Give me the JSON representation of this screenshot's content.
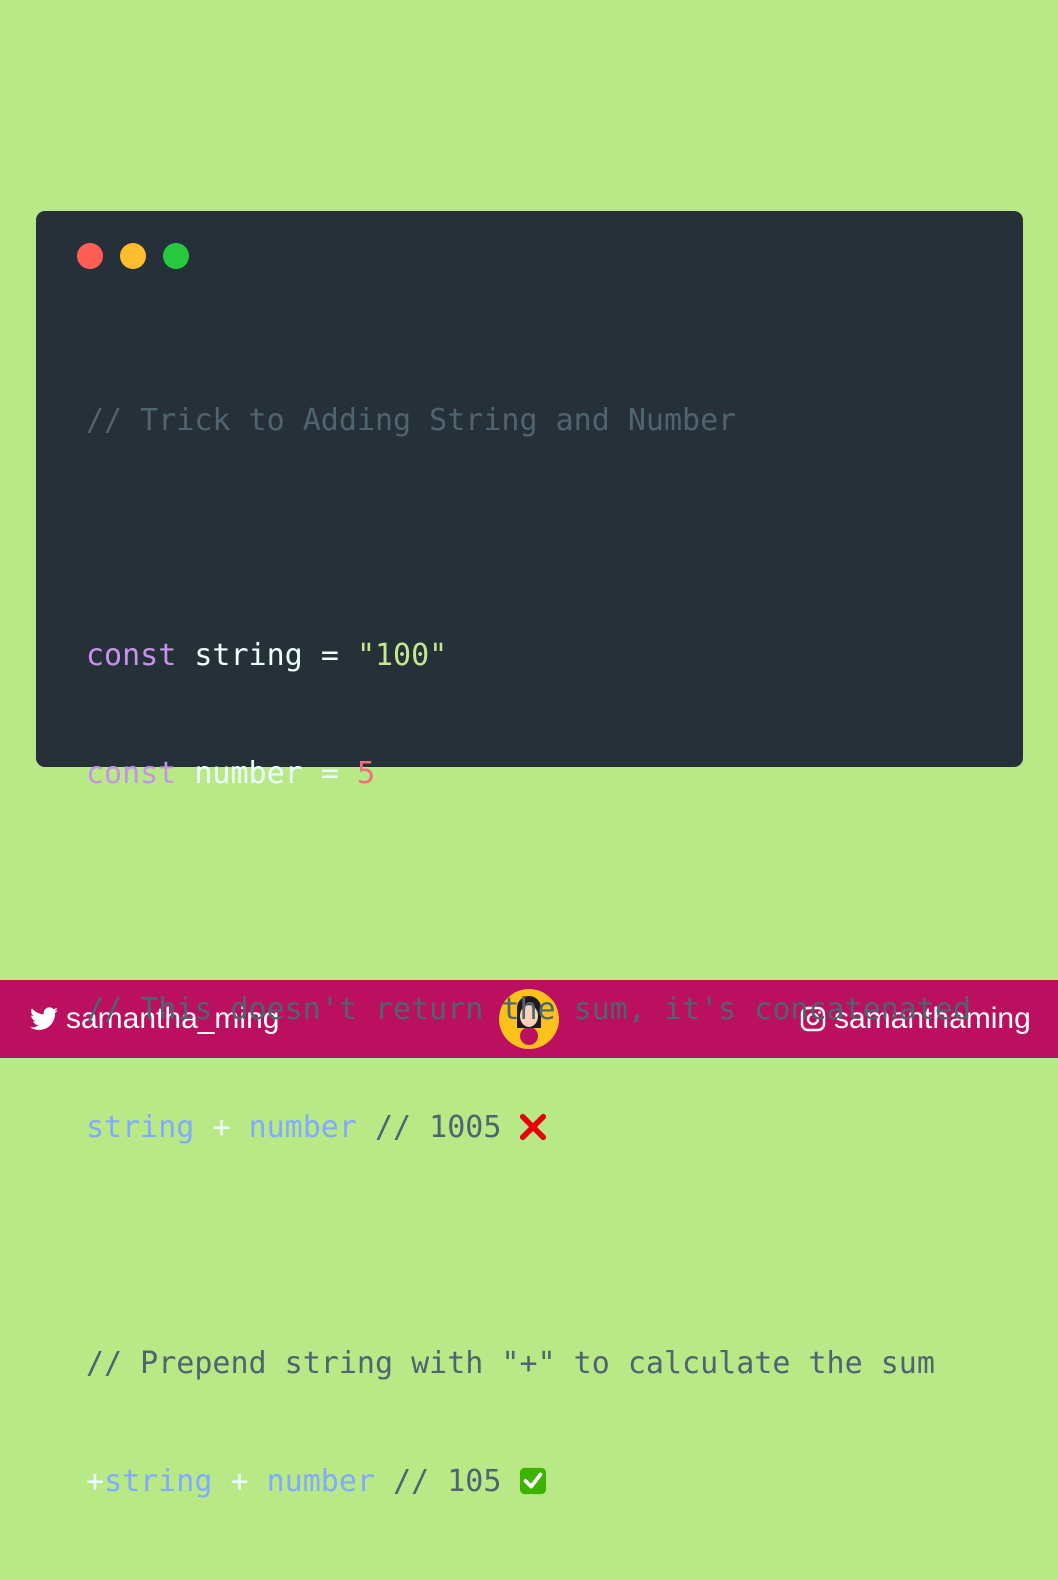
{
  "window": {
    "controls": [
      {
        "name": "close",
        "color": "#ff5f57"
      },
      {
        "name": "minimize",
        "color": "#febc2e"
      },
      {
        "name": "maximize",
        "color": "#28c840"
      }
    ]
  },
  "code": {
    "line1": {
      "comment": "// Trick to Adding String and Number"
    },
    "line2": {
      "keyword": "const",
      "name": "string",
      "op": "=",
      "value": "\"100\""
    },
    "line3": {
      "keyword": "const",
      "name": "number",
      "op": "=",
      "value": "5"
    },
    "line4": {
      "comment": "// This doesn't return the sum, it's concatenated"
    },
    "line5": {
      "a": "string",
      "op": "+",
      "b": "number",
      "comment": "// 1005",
      "emoji": "cross-mark-icon"
    },
    "line6": {
      "comment": "// Prepend string with \"+\" to calculate the sum"
    },
    "line7": {
      "prefix": "+",
      "a": "string",
      "op": "+",
      "b": "number",
      "comment": "// 105",
      "emoji": "check-mark-icon"
    }
  },
  "footer": {
    "twitter": "samantha_ming",
    "instagram": "samanthaming",
    "accent": "#bb0f60"
  },
  "colors": {
    "background": "#b9e986",
    "editor": "#263038"
  }
}
